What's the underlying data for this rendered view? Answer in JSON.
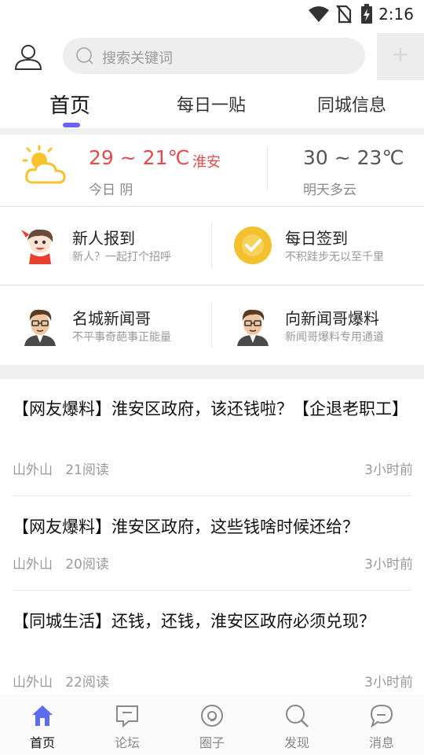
{
  "status_bar": {
    "time": "2:16"
  },
  "header": {
    "search_placeholder": "搜索关键词",
    "add_label": "+"
  },
  "tabs": [
    {
      "label": "首页",
      "active": true
    },
    {
      "label": "每日一贴",
      "active": false
    },
    {
      "label": "同城信息",
      "active": false
    }
  ],
  "weather": {
    "today_temp": "29 ~ 21℃",
    "city": "淮安",
    "today_desc": "今日 阴",
    "tomorrow_temp": "30 ~ 23℃",
    "tomorrow_desc": "明天多云"
  },
  "entries": [
    {
      "title": "新人报到",
      "subtitle": "新人？一起打个招呼"
    },
    {
      "title": "每日签到",
      "subtitle": "不积跬步无以至千里"
    },
    {
      "title": "名城新闻哥",
      "subtitle": "不平事奇葩事正能量"
    },
    {
      "title": "向新闻哥爆料",
      "subtitle": "新闻哥爆料专用通道"
    }
  ],
  "articles": [
    {
      "title": "【网友爆料】淮安区政府，该还钱啦？【企退老职工】",
      "author": "山外山",
      "reads": "21阅读",
      "time": "3小时前"
    },
    {
      "title": "【网友爆料】淮安区政府，这些钱啥时候还给？",
      "author": "山外山",
      "reads": "20阅读",
      "time": "3小时前"
    },
    {
      "title": "【同城生活】还钱，还钱，淮安区政府必须兑现？",
      "author": "山外山",
      "reads": "22阅读",
      "time": "3小时前"
    }
  ],
  "bottom_nav": [
    {
      "label": "首页",
      "icon": "home-icon",
      "active": true
    },
    {
      "label": "论坛",
      "icon": "forum-icon",
      "active": false
    },
    {
      "label": "圈子",
      "icon": "circle-icon",
      "active": false
    },
    {
      "label": "发现",
      "icon": "search-icon",
      "active": false
    },
    {
      "label": "消息",
      "icon": "message-icon",
      "active": false
    }
  ],
  "colors": {
    "accent": "#6b63f2",
    "temp_red": "#e34b4b",
    "nav_active": "#5b6cf0"
  }
}
